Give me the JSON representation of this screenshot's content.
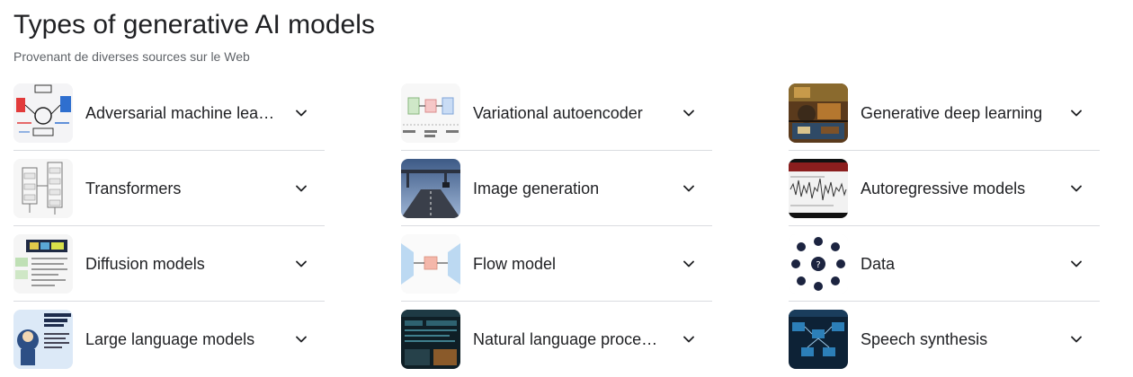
{
  "header": {
    "title": "Types of generative AI models",
    "subtitle": "Provenant de diverses sources sur le Web"
  },
  "items": [
    {
      "label": "Adversarial machine lear...",
      "icon": "gan-diagram-thumbnail"
    },
    {
      "label": "Variational autoencoder",
      "icon": "vae-diagram-thumbnail"
    },
    {
      "label": "Generative deep learning",
      "icon": "painting-thumbnail"
    },
    {
      "label": "Transformers",
      "icon": "transformer-architecture-thumbnail"
    },
    {
      "label": "Image generation",
      "icon": "highway-photo-thumbnail"
    },
    {
      "label": "Autoregressive models",
      "icon": "waveform-thumbnail"
    },
    {
      "label": "Diffusion models",
      "icon": "diffusion-chart-thumbnail"
    },
    {
      "label": "Flow model",
      "icon": "flow-diagram-thumbnail"
    },
    {
      "label": "Data",
      "icon": "data-icons-thumbnail"
    },
    {
      "label": "Large language models",
      "icon": "llm-infographic-thumbnail"
    },
    {
      "label": "Natural language process...",
      "icon": "nlp-dashboard-thumbnail"
    },
    {
      "label": "Speech synthesis",
      "icon": "speech-synthesis-diagram-thumbnail"
    }
  ],
  "colors": {
    "divider": "#dadce0",
    "text": "#202124",
    "subtext": "#5f6368"
  }
}
